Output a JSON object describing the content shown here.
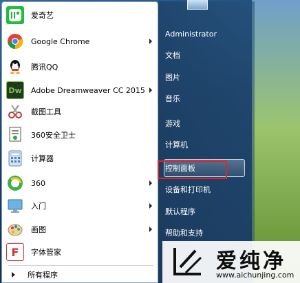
{
  "colors": {
    "highlight_border": "#e0242c",
    "left_panel_bg": "#ffffff",
    "right_panel_bg": "#1e4064"
  },
  "apps": [
    {
      "label": "爱奇艺",
      "icon": "iqiyi-icon",
      "has_submenu": false
    },
    {
      "label": "Google Chrome",
      "icon": "chrome-icon",
      "has_submenu": true
    },
    {
      "label": "腾讯QQ",
      "icon": "qq-icon",
      "has_submenu": false
    },
    {
      "label": "Adobe Dreamweaver CC 2015",
      "icon": "dreamweaver-icon",
      "has_submenu": true
    },
    {
      "label": "截图工具",
      "icon": "snipping-tool-icon",
      "has_submenu": false
    },
    {
      "label": "360安全卫士",
      "icon": "360-safe-icon",
      "has_submenu": false
    },
    {
      "label": "计算器",
      "icon": "calculator-icon",
      "has_submenu": false
    },
    {
      "label": "360",
      "icon": "360-browser-icon",
      "has_submenu": true
    },
    {
      "label": "入门",
      "icon": "getting-started-icon",
      "has_submenu": true
    },
    {
      "label": "画图",
      "icon": "paint-icon",
      "has_submenu": true
    },
    {
      "label": "字体管家",
      "icon": "font-manager-icon",
      "has_submenu": false
    }
  ],
  "all_programs": "所有程序",
  "right_panel": {
    "user": "Administrator",
    "links": [
      "文档",
      "图片",
      "音乐",
      "游戏",
      "计算机",
      "控制面板",
      "设备和打印机",
      "默认程序",
      "帮助和支持"
    ],
    "highlighted": "控制面板"
  },
  "watermark": {
    "title": "爱纯净",
    "url": "www.aichunjing.com"
  }
}
